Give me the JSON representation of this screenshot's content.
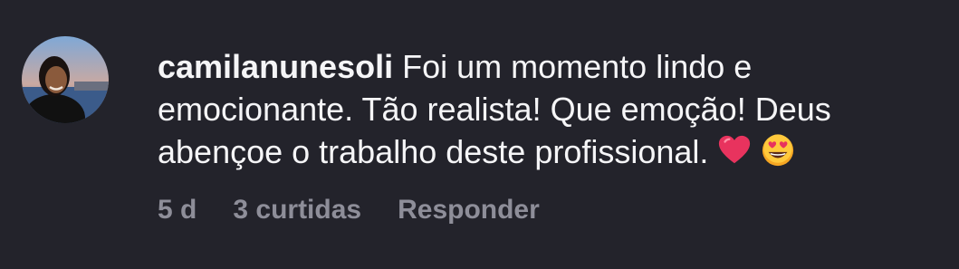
{
  "comment": {
    "username": "camilanunesoli",
    "text": "Foi um momento lindo e emocionante. Tão realista! Que emoção! Deus abençoe o trabalho deste profissional.",
    "emojis": [
      "heart-emoji",
      "heart-eyes-smiling-face-emoji"
    ],
    "time": "5 d",
    "likes": "3 curtidas",
    "reply_label": "Responder"
  },
  "colors": {
    "background": "#23232b",
    "text": "#f5f5f7",
    "meta": "#8e8e99",
    "heart": "#e8335e",
    "emoji_face": "#f5a623"
  }
}
